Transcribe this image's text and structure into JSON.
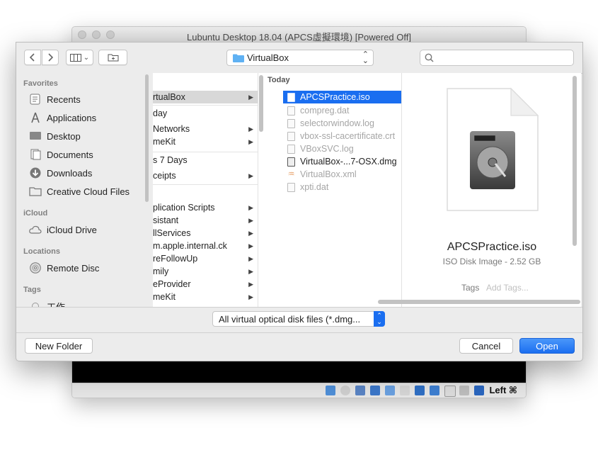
{
  "vm_window": {
    "title": "Lubuntu Desktop 18.04 (APCS虛擬環境) [Powered Off]",
    "host_key": "Left ⌘"
  },
  "toolbar": {
    "back_icon": "chevron-left-icon",
    "forward_icon": "chevron-right-icon",
    "view_icon": "column-view-icon",
    "view_chevron": "⌄",
    "new_folder_icon": "new-folder-icon",
    "path_label": "VirtualBox",
    "path_chevron": "⌃⌄",
    "search_icon": "magnifier-icon"
  },
  "sidebar": {
    "sections": [
      {
        "title": "Favorites",
        "items": [
          {
            "label": "Recents",
            "icon": "clock-icon"
          },
          {
            "label": "Applications",
            "icon": "applications-icon"
          },
          {
            "label": "Desktop",
            "icon": "desktop-icon"
          },
          {
            "label": "Documents",
            "icon": "documents-icon"
          },
          {
            "label": "Downloads",
            "icon": "download-icon"
          },
          {
            "label": "Creative Cloud Files",
            "icon": "folder-icon"
          }
        ]
      },
      {
        "title": "iCloud",
        "items": [
          {
            "label": "iCloud Drive",
            "icon": "cloud-icon"
          }
        ]
      },
      {
        "title": "Locations",
        "items": [
          {
            "label": "Remote Disc",
            "icon": "disc-icon"
          }
        ]
      },
      {
        "title": "Tags",
        "items": [
          {
            "label": "工作",
            "icon": "tag-circle-icon"
          }
        ]
      }
    ]
  },
  "column1": {
    "rows": [
      {
        "label": "rtualBox",
        "arrow": "▶",
        "selected": true
      },
      {
        "label": "day",
        "arrow": ""
      },
      {
        "label": "Networks",
        "arrow": "▶"
      },
      {
        "label": "meKit",
        "arrow": "▶"
      },
      {
        "label": "s 7 Days",
        "arrow": ""
      },
      {
        "label": "ceipts",
        "arrow": "▶"
      },
      {
        "label": "plication Scripts",
        "arrow": "▶"
      },
      {
        "label": "sistant",
        "arrow": "▶"
      },
      {
        "label": "llServices",
        "arrow": "▶"
      },
      {
        "label": "m.apple.internal.ck",
        "arrow": "▶"
      },
      {
        "label": "reFollowUp",
        "arrow": "▶"
      },
      {
        "label": "mily",
        "arrow": "▶"
      },
      {
        "label": "eProvider",
        "arrow": "▶"
      },
      {
        "label": "meKit",
        "arrow": "▶"
      }
    ]
  },
  "column2": {
    "header": "Today",
    "files": [
      {
        "name": "APCSPractice.iso",
        "state": "selected"
      },
      {
        "name": "compreg.dat",
        "state": "dim"
      },
      {
        "name": "selectorwindow.log",
        "state": "dim"
      },
      {
        "name": "vbox-ssl-cacertificate.crt",
        "state": "dim"
      },
      {
        "name": "VBoxSVC.log",
        "state": "dim"
      },
      {
        "name": "VirtualBox-...7-OSX.dmg",
        "state": "normal"
      },
      {
        "name": "VirtualBox.xml",
        "state": "dim"
      },
      {
        "name": "xpti.dat",
        "state": "dim"
      }
    ]
  },
  "preview": {
    "icon": "disk-image-icon",
    "name": "APCSPractice.iso",
    "kind": "ISO Disk Image - 2.52 GB",
    "tags_label": "Tags",
    "tags_placeholder": "Add Tags..."
  },
  "filter": {
    "label": "All virtual optical disk files (*.dmg...",
    "chevron": "⌃⌄"
  },
  "buttons": {
    "new_folder": "New Folder",
    "cancel": "Cancel",
    "open": "Open"
  },
  "colors": {
    "accent": "#1a6ef0",
    "dim_text": "#a5a5a5"
  }
}
